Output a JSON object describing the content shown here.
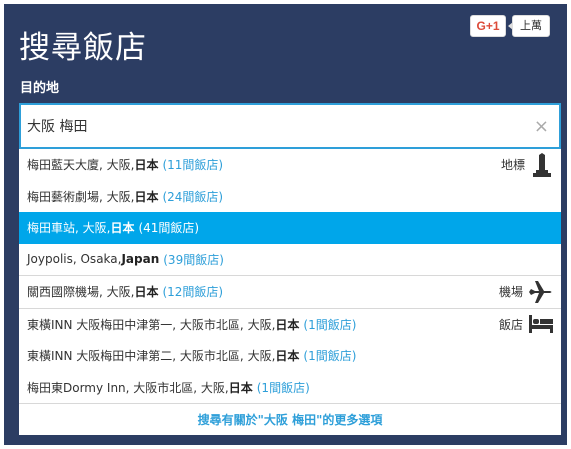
{
  "header": {
    "title": "搜尋飯店",
    "gplus_label": "G+1",
    "gplus_count": "上萬"
  },
  "destination": {
    "label": "目的地",
    "value": "大阪 梅田",
    "clear_symbol": "×"
  },
  "suggestions": [
    {
      "category_label": "地標",
      "category_icon": "landmark-icon",
      "items": [
        {
          "name": "梅田藍天大廈, 大阪, ",
          "country": "日本",
          "count": "(11間飯店)",
          "active": false
        },
        {
          "name": "梅田藝術劇場, 大阪, ",
          "country": "日本",
          "count": "(24間飯店)",
          "active": false
        },
        {
          "name": "梅田車站, 大阪, ",
          "country": "日本",
          "count": "(41間飯店)",
          "active": true
        },
        {
          "name": "Joypolis, Osaka, ",
          "country": "Japan",
          "count": "(39間飯店)",
          "active": false
        }
      ]
    },
    {
      "category_label": "機場",
      "category_icon": "airplane-icon",
      "items": [
        {
          "name": "關西國際機場, 大阪, ",
          "country": "日本",
          "count": "(12間飯店)",
          "active": false
        }
      ]
    },
    {
      "category_label": "飯店",
      "category_icon": "bed-icon",
      "items": [
        {
          "name": "東橫INN 大阪梅田中津第一, 大阪市北區, 大阪, ",
          "country": "日本",
          "count": "(1間飯店)",
          "active": false
        },
        {
          "name": "東橫INN 大阪梅田中津第二, 大阪市北區, 大阪, ",
          "country": "日本",
          "count": "(1間飯店)",
          "active": false
        },
        {
          "name": "梅田東Dormy Inn, 大阪市北區, 大阪, ",
          "country": "日本",
          "count": "(1間飯店)",
          "active": false
        }
      ]
    }
  ],
  "more_options": "搜尋有關於\"大阪 梅田\"的更多選項",
  "colors": {
    "panel_bg": "#2c3d63",
    "accent": "#2e9fd9",
    "active_row": "#00a6ea"
  }
}
